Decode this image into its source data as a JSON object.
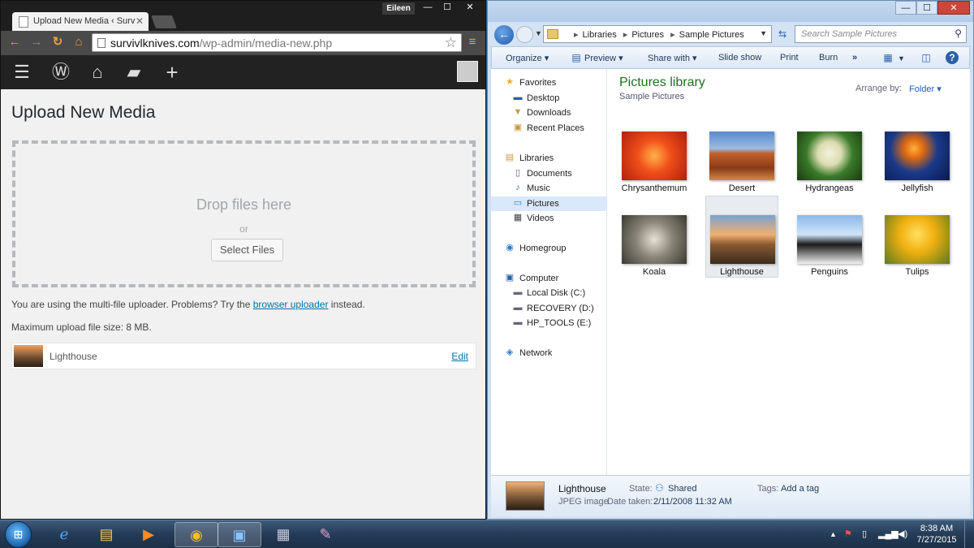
{
  "chrome": {
    "tab_title": "Upload New Media ‹ Surv",
    "user_name": "Eileen",
    "url_host": "survivlknives.com",
    "url_path": "/wp-admin/media-new.php"
  },
  "wordpress": {
    "page_title": "Upload New Media",
    "drop_text": "Drop files here",
    "or_text": "or",
    "select_files_label": "Select Files",
    "note_prefix": "You are using the multi-file uploader. Problems? Try the ",
    "note_link": "browser uploader",
    "note_suffix": " instead.",
    "max_upload": "Maximum upload file size: 8 MB.",
    "media_item_title": "Lighthouse",
    "media_item_edit": "Edit"
  },
  "explorer": {
    "breadcrumb": [
      "Libraries",
      "Pictures",
      "Sample Pictures"
    ],
    "search_placeholder": "Search Sample Pictures",
    "commands": {
      "organize": "Organize",
      "preview": "Preview",
      "share_with": "Share with",
      "slide_show": "Slide show",
      "print": "Print",
      "burn": "Burn",
      "more": "»"
    },
    "nav": {
      "favorites": "Favorites",
      "desktop": "Desktop",
      "downloads": "Downloads",
      "recent_places": "Recent Places",
      "libraries": "Libraries",
      "documents": "Documents",
      "music": "Music",
      "pictures": "Pictures",
      "videos": "Videos",
      "homegroup": "Homegroup",
      "computer": "Computer",
      "local_disk": "Local Disk (C:)",
      "recovery": "RECOVERY (D:)",
      "hp_tools": "HP_TOOLS (E:)",
      "network": "Network"
    },
    "library_title": "Pictures library",
    "library_subtitle": "Sample Pictures",
    "arrange_by_label": "Arrange by:",
    "arrange_by_value": "Folder",
    "pictures": [
      {
        "label": "Chrysanthemum"
      },
      {
        "label": "Desert"
      },
      {
        "label": "Hydrangeas"
      },
      {
        "label": "Jellyfish"
      },
      {
        "label": "Koala"
      },
      {
        "label": "Lighthouse"
      },
      {
        "label": "Penguins"
      },
      {
        "label": "Tulips"
      }
    ],
    "details": {
      "name": "Lighthouse",
      "type": "JPEG image",
      "state_label": "State:",
      "state_value": "Shared",
      "date_label": "Date taken:",
      "date_value": "2/11/2008 11:32 AM",
      "tags_label": "Tags:",
      "tags_value": "Add a tag"
    }
  },
  "taskbar": {
    "time": "8:38 AM",
    "date": "7/27/2015"
  }
}
